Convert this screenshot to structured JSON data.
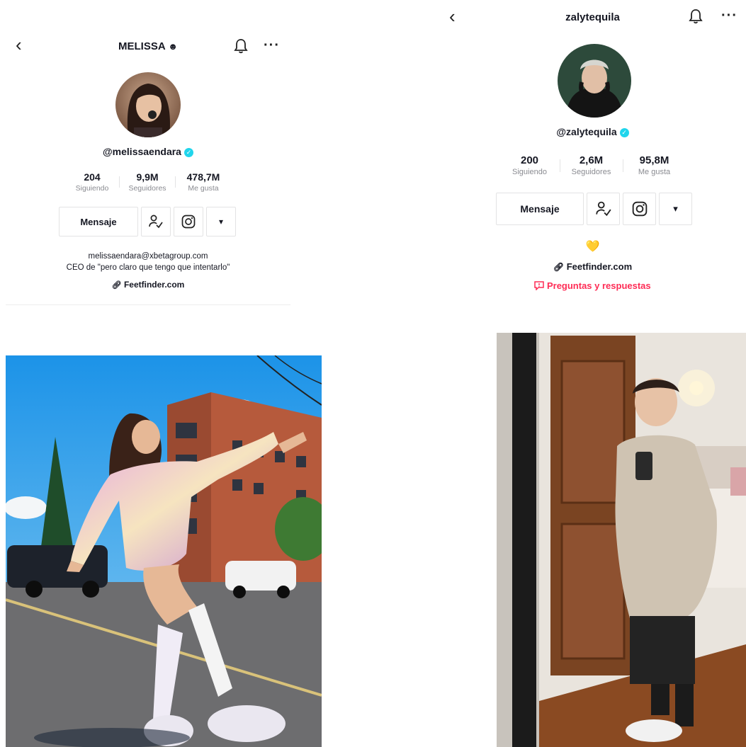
{
  "left_profile": {
    "title": "MELISSA",
    "title_emoji": "☻",
    "handle": "@melissaendara",
    "stats": [
      {
        "value": "204",
        "label": "Siguiendo"
      },
      {
        "value": "9,9M",
        "label": "Seguidores"
      },
      {
        "value": "478,7M",
        "label": "Me gusta"
      }
    ],
    "message_label": "Mensaje",
    "bio_line_1": "melissaendara@xbetagroup.com",
    "bio_line_2": "CEO de \"pero claro que tengo que intentarlo\"",
    "link": "Feetfinder.com"
  },
  "right_profile": {
    "title": "zalytequila",
    "handle": "@zalytequila",
    "stats": [
      {
        "value": "200",
        "label": "Siguiendo"
      },
      {
        "value": "2,6M",
        "label": "Seguidores"
      },
      {
        "value": "95,8M",
        "label": "Me gusta"
      }
    ],
    "message_label": "Mensaje",
    "bio_emoji": "💛",
    "link": "Feetfinder.com",
    "qa_label": "Preguntas y respuestas"
  },
  "icons": {
    "back": "‹",
    "more": "···",
    "dropdown": "▾",
    "link": "🔗"
  },
  "colors": {
    "verified": "#20d5ec",
    "qa_red": "#fe2c55",
    "secondary_text": "#8a8b91"
  }
}
